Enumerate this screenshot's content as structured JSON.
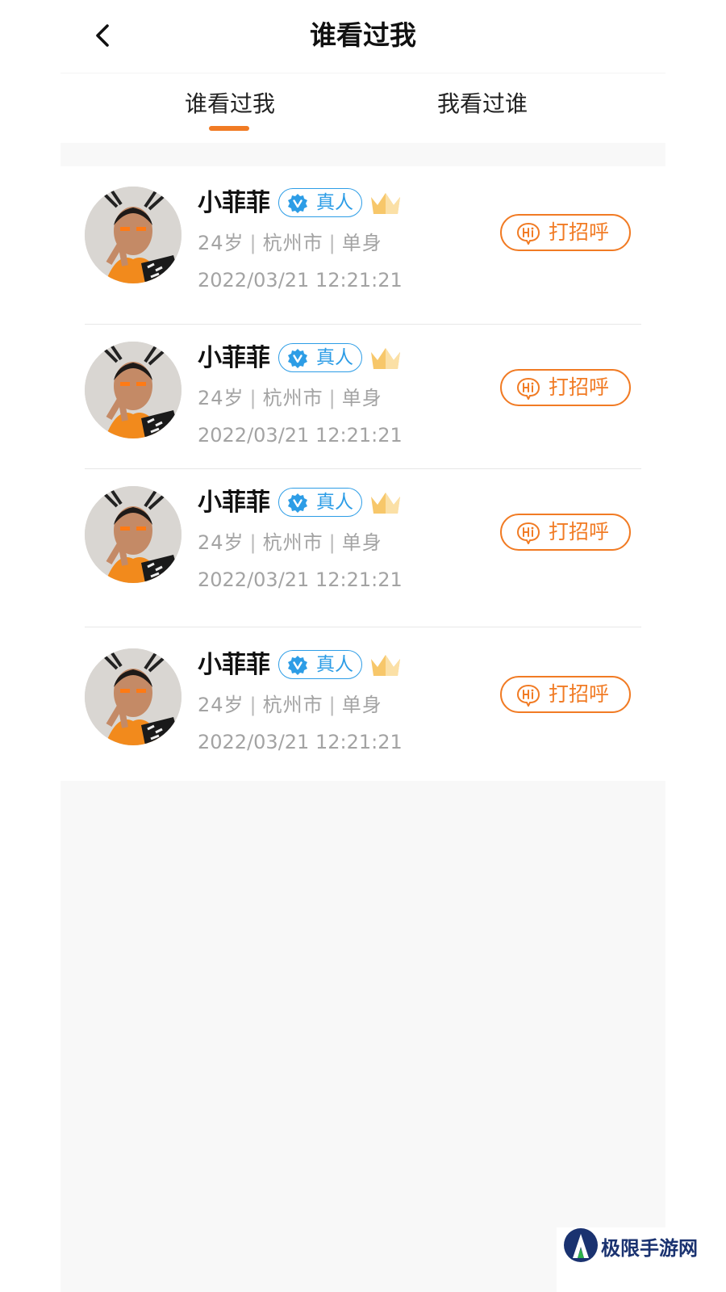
{
  "header": {
    "title": "谁看过我"
  },
  "tabs": [
    {
      "label": "谁看过我",
      "active": true
    },
    {
      "label": "我看过谁",
      "active": false
    }
  ],
  "colors": {
    "accent": "#f17b24",
    "verify": "#2d9de6",
    "crown": "#f7c76a"
  },
  "icons": {
    "back": "chevron-left-icon",
    "verify": "verified-shield-icon",
    "vip": "crown-icon",
    "greet": "hi-bubble-icon"
  },
  "visitors": [
    {
      "name": "小菲菲",
      "verify_label": "真人",
      "age": "24岁",
      "city": "杭州市",
      "status": "单身",
      "time": "2022/03/21 12:21:21",
      "greet_label": "打招呼"
    },
    {
      "name": "小菲菲",
      "verify_label": "真人",
      "age": "24岁",
      "city": "杭州市",
      "status": "单身",
      "time": "2022/03/21 12:21:21",
      "greet_label": "打招呼"
    },
    {
      "name": "小菲菲",
      "verify_label": "真人",
      "age": "24岁",
      "city": "杭州市",
      "status": "单身",
      "time": "2022/03/21 12:21:21",
      "greet_label": "打招呼"
    },
    {
      "name": "小菲菲",
      "verify_label": "真人",
      "age": "24岁",
      "city": "杭州市",
      "status": "单身",
      "time": "2022/03/21 12:21:21",
      "greet_label": "打招呼"
    }
  ],
  "watermark": {
    "text": "极限手游网"
  }
}
